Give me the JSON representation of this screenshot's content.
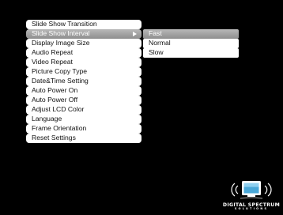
{
  "menu": {
    "items": [
      {
        "label": "Slide Show Transition"
      },
      {
        "label": "Slide Show Interval"
      },
      {
        "label": "Display Image Size"
      },
      {
        "label": "Audio Repeat"
      },
      {
        "label": "Video Repeat"
      },
      {
        "label": "Picture Copy Type"
      },
      {
        "label": "Date&Time Setting"
      },
      {
        "label": "Auto Power On"
      },
      {
        "label": "Auto Power Off"
      },
      {
        "label": "Adjust LCD Color"
      },
      {
        "label": "Language"
      },
      {
        "label": "Frame Orientation"
      },
      {
        "label": "Reset Settings"
      }
    ],
    "selected_label": "Slide Show Interval"
  },
  "submenu": {
    "items": [
      {
        "label": "Fast"
      },
      {
        "label": "Normal"
      },
      {
        "label": "Slow"
      }
    ],
    "selected_label": "Fast"
  },
  "brand": {
    "name": "DIGITAL SPECTRUM",
    "tagline": "SOLUTIONS",
    "icon": "digital-frame-wireless-logo"
  },
  "colors": {
    "background": "#000000",
    "item_bg": "#ffffff",
    "selected_bg": "#a0a0a0"
  }
}
